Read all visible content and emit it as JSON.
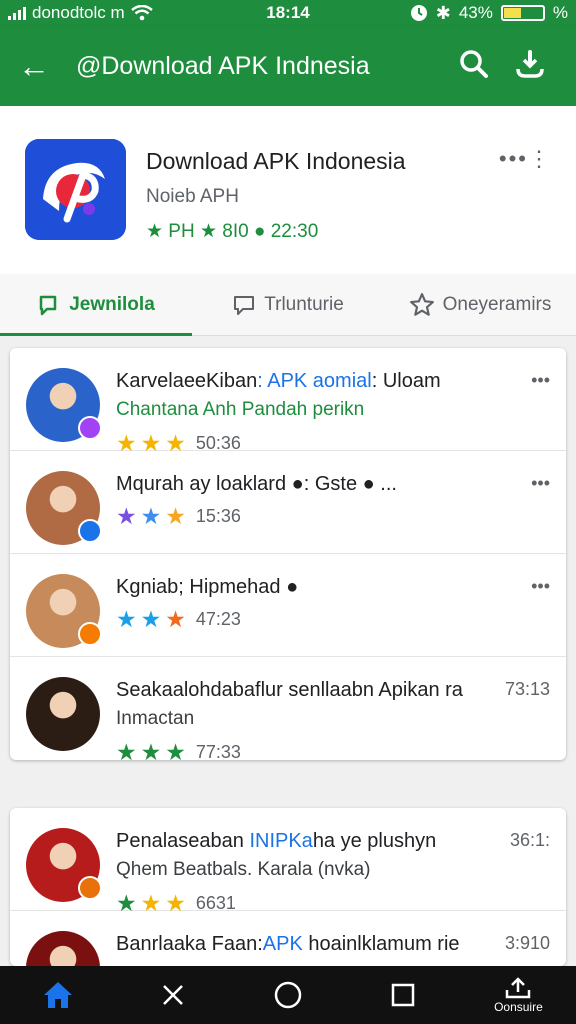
{
  "status_bar": {
    "carrier": "donodtolc m",
    "time": "18:14",
    "battery": "43%",
    "battery_level": 0.43,
    "extra": "%"
  },
  "app_bar": {
    "title": "@Download APK Indnesia",
    "color": "#1e8e3e"
  },
  "app_header": {
    "name": "Download APK Indonesia",
    "subtitle": "Noieb APH",
    "rating": "★ PH ★ 8I0 ● 22:30"
  },
  "tabs": [
    {
      "label": "Jewnilola",
      "icon": "chat-icon",
      "active": true
    },
    {
      "label": "Trlunturie",
      "icon": "message-icon",
      "active": false
    },
    {
      "label": "Oneyeramirs",
      "icon": "star-icon",
      "active": false
    }
  ],
  "list_items": [
    {
      "title": "KarvelaeeKiban",
      "title_highlight": ": APK aomial",
      "title_tail": ": Uloam",
      "subtitle": "Chantana Anh Pandah perikn",
      "rating": "50:36",
      "stars": [
        "#f5b400",
        "#f5b400",
        "#f5b400"
      ],
      "right": "•••",
      "badge_color": "#a142f4",
      "avatar_color": "#2a63c9"
    },
    {
      "title": "Mqurah ay loaklard",
      "title_highlight": "",
      "title_tail": " ●: Gste ● ...",
      "subtitle": "",
      "rating": "15:36",
      "stars": [
        "#7b4fe0",
        "#3d8ef0",
        "#f5a623"
      ],
      "right": "•••",
      "badge_color": "#1a73e8",
      "avatar_color": "#b06a44"
    },
    {
      "title": "Kgniab; Hipmehad",
      "title_highlight": "",
      "title_tail": " ●",
      "subtitle": "",
      "rating": "47:23",
      "stars": [
        "#1aa0e8",
        "#1aa0e8",
        "#f26b1d"
      ],
      "right": "•••",
      "badge_color": "#f57c00",
      "avatar_color": "#c78a5a"
    },
    {
      "title": "Seakaalohdabaflur senllaabn Apikan ra",
      "title_highlight": "",
      "title_tail": "",
      "subtitle": "Inmactan",
      "rating": "77:33",
      "stars": [
        "#1e8e3e",
        "#1e8e3e",
        "#1e8e3e"
      ],
      "right": "73:13",
      "badge_color": "",
      "avatar_color": "#2b1d14"
    }
  ],
  "list_items_2": [
    {
      "title": "Penalaseaban",
      "title_highlight": " INIPKa",
      "title_tail": "ha ye plushyn",
      "subtitle": "Qhem Beatbals. Karala (nvka)",
      "rating": "6631",
      "stars": [
        "#1e8e3e",
        "#f5b400",
        "#f5b400"
      ],
      "right": "36:1:",
      "badge_color": "#e8710a",
      "avatar_color": "#b71c1c"
    },
    {
      "title": "Banrlaaka Faan:",
      "title_highlight": "APK",
      "title_tail": " hoainlklamum rie",
      "subtitle": "",
      "rating": "",
      "stars": [],
      "right": "3:910",
      "badge_color": "",
      "avatar_color": "#7a1010"
    }
  ],
  "nav_bar": {
    "items": [
      {
        "icon": "home-icon",
        "label": ""
      },
      {
        "icon": "close-icon",
        "label": ""
      },
      {
        "icon": "circle-icon",
        "label": ""
      },
      {
        "icon": "square-icon",
        "label": ""
      },
      {
        "icon": "upload-icon",
        "label": "Oonsuire"
      }
    ]
  }
}
